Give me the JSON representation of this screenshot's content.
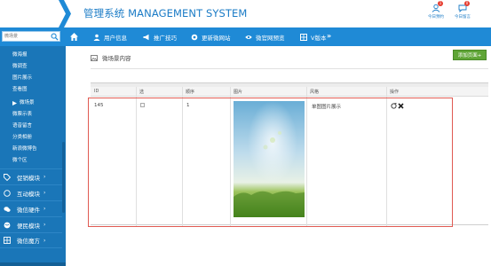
{
  "header": {
    "title": "管理系统 MANAGEMENT SYSTEM",
    "links": [
      {
        "label": "今日预约",
        "badge": "1"
      },
      {
        "label": "今日留言",
        "badge": "0"
      }
    ]
  },
  "navbar": {
    "search": {
      "placeholder": "微场景"
    },
    "items": [
      {
        "label": "用户信息"
      },
      {
        "label": "推广技巧"
      },
      {
        "label": "更新微网站"
      },
      {
        "label": "微官网预览"
      },
      {
        "label": "V版本"
      }
    ],
    "more": "»"
  },
  "sidebar": {
    "sub_items": [
      {
        "label": "微海报"
      },
      {
        "label": "微调查"
      },
      {
        "label": "图片展示"
      },
      {
        "label": "查看图"
      },
      {
        "label": "微场景"
      },
      {
        "label": "微票示表"
      },
      {
        "label": "语音留言"
      },
      {
        "label": "分类相册"
      },
      {
        "label": "新浪微博告"
      },
      {
        "label": "微个区"
      }
    ],
    "groups": [
      {
        "label": "促销模块"
      },
      {
        "label": "互动模块"
      },
      {
        "label": "微信硬件"
      },
      {
        "label": "便民模块"
      },
      {
        "label": "微信魔方"
      }
    ]
  },
  "main": {
    "page_title": "微场景内容",
    "add_button": "添加页面+",
    "table": {
      "columns": [
        "ID",
        "选",
        "顺序",
        "图片",
        "风格",
        "操作"
      ],
      "rows": [
        {
          "id": "145",
          "order": "1",
          "style": "单图图片展示"
        }
      ]
    }
  },
  "colors": {
    "nav_blue": "#1f8ad6",
    "sidebar_blue": "#1a76b8",
    "title_blue": "#1a7bc6",
    "add_green": "#5fa536",
    "highlight_red": "#e05a52"
  },
  "icons": {
    "home": "home-icon",
    "search": "search-icon",
    "edit": "edit-icon",
    "delete": "delete-icon"
  }
}
